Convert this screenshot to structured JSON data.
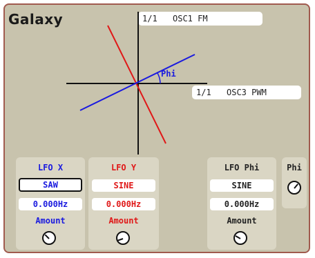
{
  "app": {
    "title": "Galaxy"
  },
  "routing": {
    "top": {
      "ratio": "1/1",
      "target": "OSC1 FM"
    },
    "right": {
      "ratio": "1/1",
      "target": "OSC3 PWM"
    }
  },
  "scope": {
    "angle_label": "Phi"
  },
  "lfo_x": {
    "label": "LFO X",
    "wave": "SAW",
    "rate": "0.000Hz",
    "amount_label": "Amount",
    "color": "#1a1adf"
  },
  "lfo_y": {
    "label": "LFO Y",
    "wave": "SINE",
    "rate": "0.000Hz",
    "amount_label": "Amount",
    "color": "#e01818"
  },
  "lfo_phi": {
    "label": "LFO Phi",
    "wave": "SINE",
    "rate": "0.000Hz",
    "amount_label": "Amount",
    "color": "#222222"
  },
  "phi": {
    "label": "Phi"
  }
}
